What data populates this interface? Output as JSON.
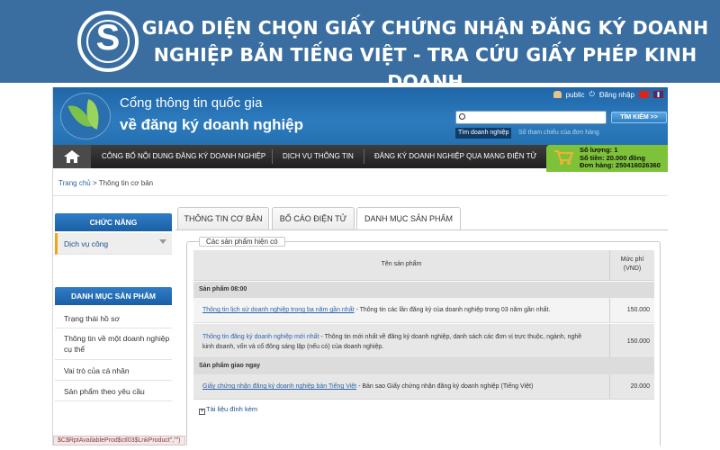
{
  "banner": {
    "title_line1": "GIAO DIỆN CHỌN GIẤY CHỨNG NHẬN ĐĂNG KÝ DOANH",
    "title_line2": "NGHIỆP BẢN TIẾNG VIỆT - TRA CỨU GIẤY PHÉP KINH DOANH",
    "logo_glyph": "S",
    "logo_icon": "dollar-coin-icon"
  },
  "portal": {
    "title_line1": "Cổng thông tin quốc gia",
    "title_line2": "về đăng ký doanh nghiệp",
    "user": "public",
    "login": "Đăng nhập",
    "search": {
      "placeholder": "",
      "button": "TÌM KIẾM >>",
      "tab_active": "Tìm doanh nghiệp",
      "tab_inactive": "Số tham chiếu của đơn hàng"
    }
  },
  "nav": {
    "items": [
      "CÔNG BỐ NỘI DUNG ĐĂNG KÝ DOANH NGHIỆP",
      "DỊCH VỤ THÔNG TIN",
      "ĐĂNG KÝ DOANH NGHIỆP QUA MẠNG ĐIỆN TỬ"
    ]
  },
  "cart": {
    "quantity": "Số lượng: 1",
    "amount": "Số tiền: 20.000 đồng",
    "order": "Đơn hàng: 250416026360"
  },
  "breadcrumb": {
    "home": "Trang chủ",
    "sep": ">",
    "current": "Thông tin cơ bản"
  },
  "sidebar": {
    "functions_title": "CHỨC NĂNG",
    "functions": [
      "Dịch vụ công"
    ],
    "products_title": "DANH MỤC SẢN PHẨM",
    "products": [
      "Trạng thái hồ sơ",
      "Thông tin về một doanh nghiệp cụ thể",
      "Vai trò của cá nhân",
      "Sản phẩm theo yêu cầu"
    ]
  },
  "tabs": [
    "THÔNG TIN CƠ BẢN",
    "BỐ CÁO ĐIỆN TỬ",
    "DANH MỤC SẢN PHẨM"
  ],
  "products": {
    "legend": "Các sản phẩm hiện có",
    "col_name": "Tên sản phẩm",
    "col_fee_1": "Mức phí",
    "col_fee_2": "(VND)",
    "groups": [
      {
        "title": "Sản phẩm 08:00",
        "rows": [
          {
            "link": "Thông tin lịch sử doanh nghiệp trong ba năm gần nhất",
            "desc": " - Thông tin các lần đăng ký của doanh nghiệp trong 03 năm gần nhất.",
            "price": "150.000"
          },
          {
            "link": "Thông tin đăng ký doanh nghiệp mới nhất",
            "desc": " - Thông tin mới nhất về đăng ký doanh nghiệp, danh sách các đơn vị trực thuộc, ngành, nghề",
            "desc2": "kinh doanh, vốn và cổ đông sáng lập (nếu có) của doanh nghiệp.",
            "price": "150.000"
          }
        ]
      },
      {
        "title": "Sản phẩm giao ngay",
        "rows": [
          {
            "link": "Giấy chứng nhận đăng ký doanh nghiệp bản Tiếng Việt",
            "desc": " - Bản sao Giấy chứng nhận đăng ký doanh nghiệp (Tiếng Việt)",
            "price": "20.000"
          }
        ]
      }
    ],
    "attach": "Tài liệu đính kèm",
    "attach_box": "+"
  },
  "status_bar": "$C$RptAvailableProd$ctl03$LnkProduct\",\"\")"
}
